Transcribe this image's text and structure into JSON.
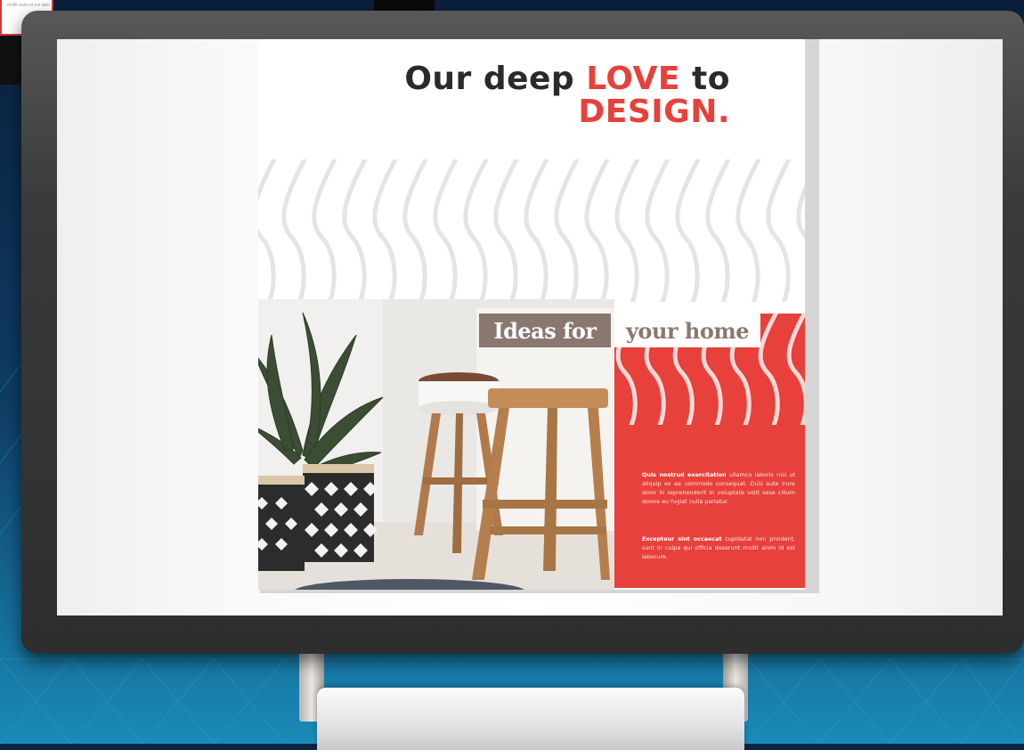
{
  "slide": {
    "headline": {
      "word1": "Our deep",
      "accent1": "LOVE",
      "word2": "to",
      "accent2": "DESIGN."
    },
    "section_label": {
      "part1": "Ideas for",
      "part2": "your home"
    },
    "paragraphs": [
      {
        "bold": "Quis nostrud exercitation",
        "rest": " ullamco laboris nisi ut aliquip ex ea commodo consequat. Duis aute irure dolor in reprehenderit in voluptate velit esse cillum dolore eu fugiat nulla pariatur."
      },
      {
        "bold": "Excepteur sint occaecat",
        "rest": " cupidatat non proident, sunt in culpa qui officia deserunt mollit anim id est laborum."
      }
    ]
  },
  "background_card": {
    "snippet": "mollit anim id est laborum."
  },
  "colors": {
    "accent_red": "#e8403a",
    "headline_dark": "#2a2a2a",
    "label_taupe": "#8a7870",
    "bezel": "#333333",
    "background_navy": "#0c2440",
    "background_teal": "#1a7aa8"
  },
  "icons": [
    "wave-pattern",
    "plant",
    "wooden-stool",
    "woven-basket"
  ]
}
